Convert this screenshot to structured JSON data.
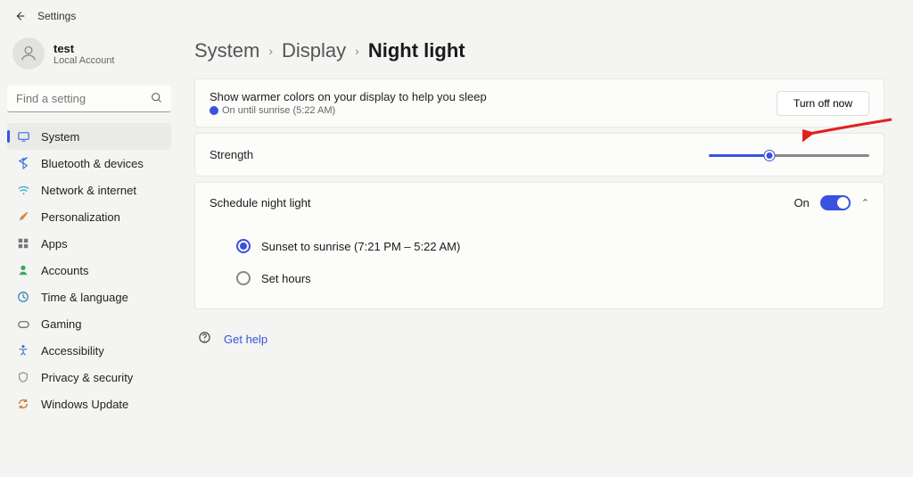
{
  "app": {
    "title": "Settings"
  },
  "account": {
    "name": "test",
    "subtitle": "Local Account"
  },
  "search": {
    "placeholder": "Find a setting"
  },
  "nav": {
    "system": "System",
    "bluetooth": "Bluetooth & devices",
    "network": "Network & internet",
    "personalization": "Personalization",
    "apps": "Apps",
    "accounts": "Accounts",
    "timelang": "Time & language",
    "gaming": "Gaming",
    "accessibility": "Accessibility",
    "privacy": "Privacy & security",
    "update": "Windows Update"
  },
  "breadcrumb": {
    "sys": "System",
    "disp": "Display",
    "page": "Night light"
  },
  "intro": {
    "desc": "Show warmer colors on your display to help you sleep",
    "status": "On until sunrise (5:22 AM)",
    "button": "Turn off now"
  },
  "strength": {
    "label": "Strength",
    "value": 38
  },
  "schedule": {
    "label": "Schedule night light",
    "state": "On",
    "opt_sunset": "Sunset to sunrise (7:21 PM – 5:22 AM)",
    "opt_hours": "Set hours",
    "selected": "sunset"
  },
  "help": {
    "label": "Get help"
  },
  "colors": {
    "accent": "#3a52e0"
  }
}
